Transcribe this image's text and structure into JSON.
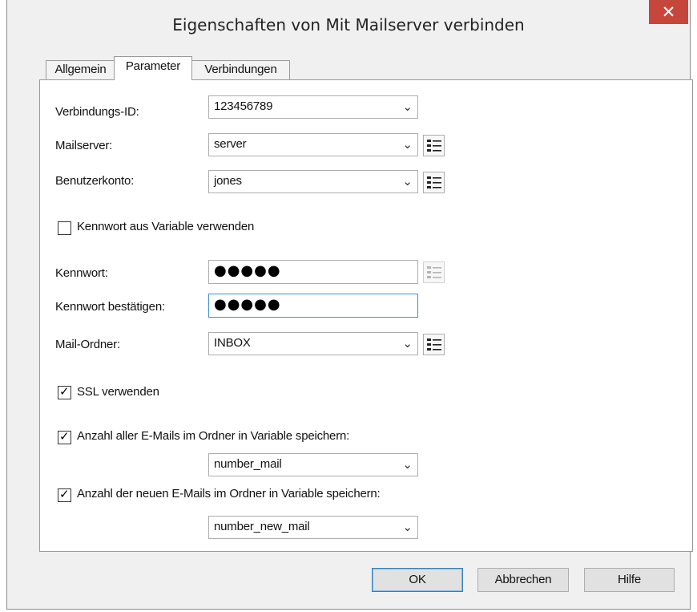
{
  "window": {
    "title": "Eigenschaften von Mit Mailserver verbinden",
    "close_glyph": "✕"
  },
  "tabs": [
    {
      "label": "Allgemein",
      "active": false
    },
    {
      "label": "Parameter",
      "active": true
    },
    {
      "label": "Verbindungen",
      "active": false
    }
  ],
  "form": {
    "connection_id": {
      "label": "Verbindungs-ID:",
      "value": "123456789"
    },
    "mailserver": {
      "label": "Mailserver:",
      "value": "server"
    },
    "account": {
      "label": "Benutzerkonto:",
      "value": "jones"
    },
    "use_password_variable": {
      "label": "Kennwort aus Variable verwenden",
      "checked": false
    },
    "password": {
      "label": "Kennwort:",
      "masked": "●●●●●"
    },
    "password_confirm": {
      "label": "Kennwort bestätigen:",
      "masked": "●●●●●"
    },
    "mail_folder": {
      "label": "Mail-Ordner:",
      "value": "INBOX"
    },
    "use_ssl": {
      "label": "SSL verwenden",
      "checked": true
    },
    "store_all_count": {
      "label": "Anzahl aller E-Mails im Ordner in Variable speichern:",
      "checked": true,
      "variable": "number_mail"
    },
    "store_new_count": {
      "label": "Anzahl der neuen E-Mails im Ordner in Variable speichern:",
      "checked": true,
      "variable": "number_new_mail"
    }
  },
  "glyphs": {
    "chevron": "⌄",
    "check": "✓"
  },
  "icons": {
    "close": "close-icon",
    "dropdown": "chevron-down-icon",
    "list": "list-icon",
    "check": "checkmark-icon"
  },
  "buttons": {
    "ok": "OK",
    "cancel": "Abbrechen",
    "help": "Hilfe"
  },
  "colors": {
    "close_bg": "#c7463c",
    "focus_border": "#3f8fd2",
    "default_button_border": "#3c7fb1"
  }
}
